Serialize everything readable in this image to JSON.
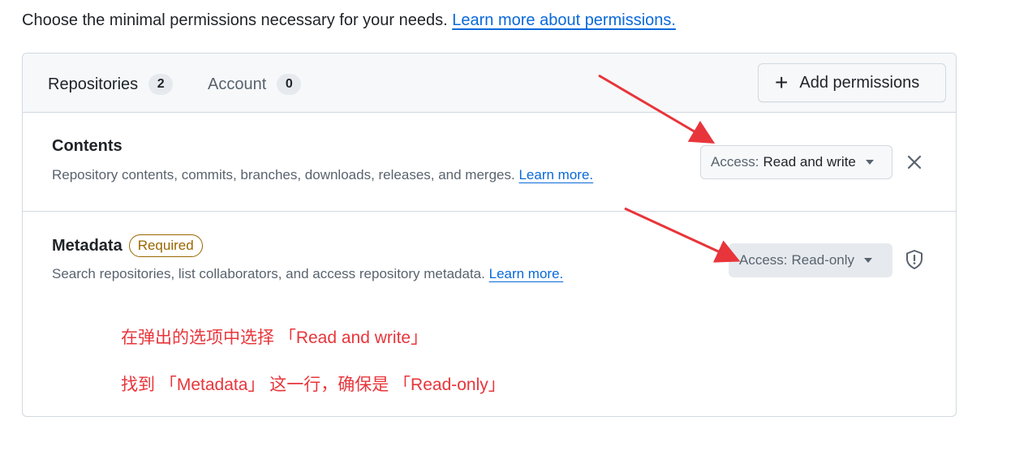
{
  "intro": {
    "text": "Choose the minimal permissions necessary for your needs.",
    "link": "Learn more about permissions."
  },
  "tabs": [
    {
      "label": "Repositories",
      "count": "2"
    },
    {
      "label": "Account",
      "count": "0"
    }
  ],
  "add_button": {
    "label": "Add permissions",
    "icon": "plus-icon"
  },
  "permissions": [
    {
      "title": "Contents",
      "description": "Repository contents, commits, branches, downloads, releases, and merges.",
      "link": "Learn more.",
      "access_prefix": "Access:",
      "access_value": "Read and write",
      "action_icon": "close-icon"
    },
    {
      "title": "Metadata",
      "badge": "Required",
      "description": "Search repositories, list collaborators, and access repository metadata.",
      "link": "Learn more.",
      "access_prefix": "Access:",
      "access_value": "Read-only",
      "action_icon": "shield-icon"
    }
  ],
  "annotations": [
    "在弹出的选项中选择 「Read and write」",
    "找到 「Metadata」 这一行，确保是 「Read-only」"
  ],
  "colors": {
    "link": "#0969da",
    "annotation": "#e8353b",
    "badge": "#9a6700",
    "border": "#d1d9e0"
  }
}
